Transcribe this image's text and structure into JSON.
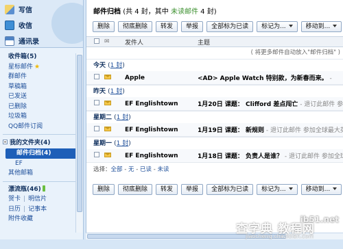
{
  "sidebar": {
    "quick": [
      {
        "label": "写信"
      },
      {
        "label": "收信"
      },
      {
        "label": "通讯录"
      }
    ],
    "inbox": "收件箱(5)",
    "starred": "星标邮件",
    "star_glyph": "★",
    "folders": [
      "群邮件",
      "草稿箱",
      "已发送",
      "已删除",
      "垃圾箱",
      "QQ邮件订阅"
    ],
    "my_folders_head": "我的文件夹(4)",
    "my_folders": {
      "selected": "邮件归档(4)",
      "sub": "EF",
      "other": "其他邮箱"
    },
    "drift_bottle": "漂流瓶(46)",
    "pairs": [
      {
        "left": "贺卡",
        "right": "明信片"
      },
      {
        "left": "日历",
        "right": "记事本"
      }
    ],
    "attachments": "附件收藏"
  },
  "main": {
    "title": "邮件归档",
    "count_prefix": "(共 4 封，其中 ",
    "unread_label": "未读邮件",
    "count_suffix": " 4 封)",
    "toolbar": {
      "delete": "删除",
      "perm_delete": "彻底删除",
      "forward": "转发",
      "report": "举报",
      "mark_all_read": "全部标为已读",
      "mark_as": "标记为...",
      "move_to": "移动到..."
    },
    "columns": {
      "sender": "发件人",
      "subject": "主题"
    },
    "auto_note": "( 将更多邮件自动放入\"邮件归档\" )",
    "groups": [
      {
        "day": "今天",
        "count": "1 封",
        "sender": "Apple",
        "subject": "<AD> Apple Watch 特别款，为新春而来。",
        "snippet": " - "
      },
      {
        "day": "昨天",
        "count": "1 封",
        "sender": "EF Englishtown",
        "subject": "1月20日 课题： Clifford 差点闯亡",
        "snippet": " - 退订此邮件 参加全球"
      },
      {
        "day": "星期二",
        "count": "1 封",
        "sender": "EF Englishtown",
        "subject": "1月19日 课题： 新规则",
        "snippet": " - 退订此邮件 参加全球最大英语"
      },
      {
        "day": "星期一",
        "count": "1 封",
        "sender": "EF Englishtown",
        "subject": "1月18日 课题： 负责人是谁？",
        "snippet": " - 退订此邮件 参加全球最"
      }
    ],
    "select_line": {
      "label": "选择：",
      "all": "全部",
      "none": "无",
      "read": "已读",
      "unread": "未读"
    }
  },
  "watermark": {
    "brand_top": "ib51.net",
    "brand_main": "查字典 教程网",
    "url": "jiaocheng.chazidian.com"
  }
}
